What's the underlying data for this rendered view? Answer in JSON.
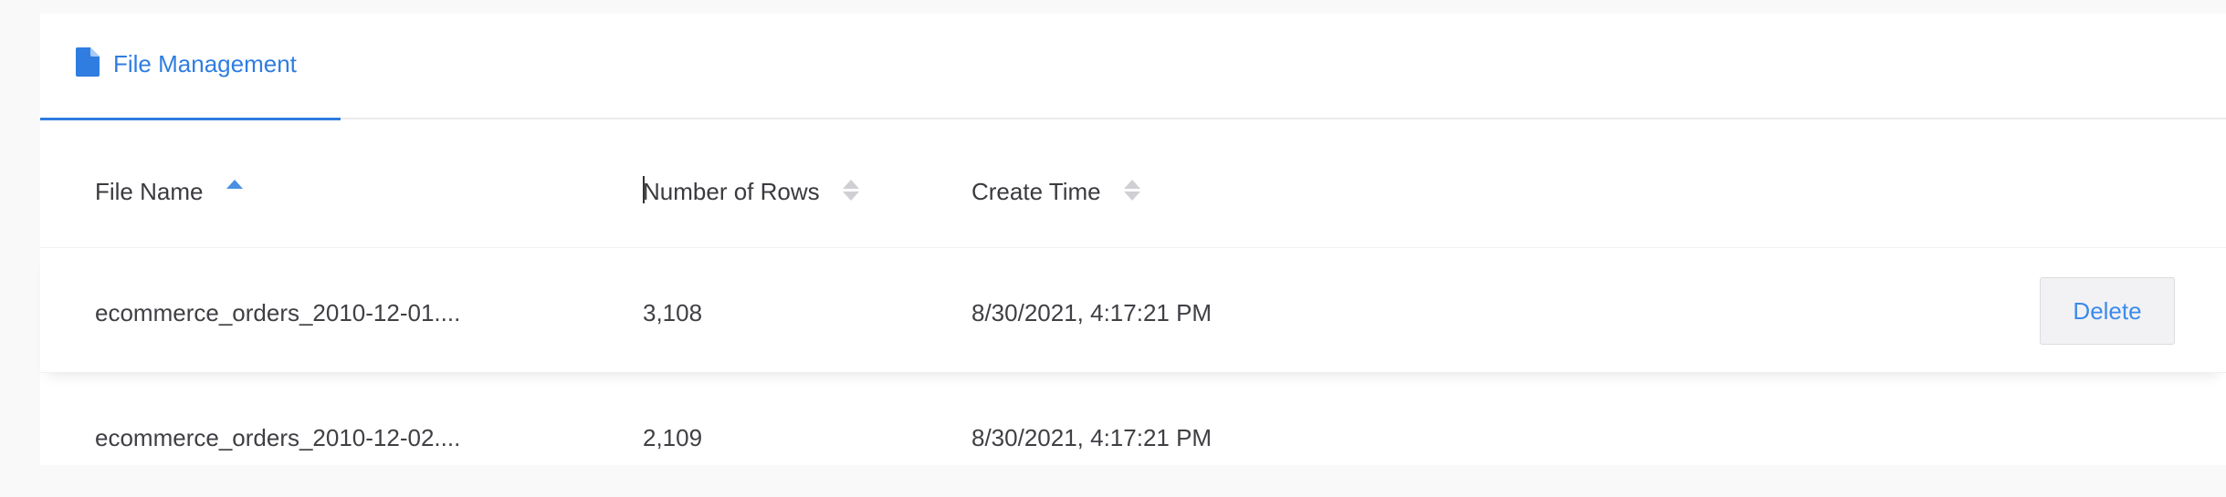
{
  "tabs": [
    {
      "label": "File Management",
      "icon": "file-icon",
      "active": true
    }
  ],
  "table": {
    "columns": [
      {
        "label": "File Name",
        "sort": "ascending"
      },
      {
        "label": "Number of Rows",
        "sort": "none"
      },
      {
        "label": "Create Time",
        "sort": "none"
      }
    ],
    "rows": [
      {
        "file_name": "ecommerce_orders_2010-12-01....",
        "number_of_rows": "3,108",
        "create_time": "8/30/2021, 4:17:21 PM",
        "action_label": "Delete"
      },
      {
        "file_name": "ecommerce_orders_2010-12-02....",
        "number_of_rows": "2,109",
        "create_time": "8/30/2021, 4:17:21 PM"
      }
    ]
  },
  "colors": {
    "accent": "#2f7de1",
    "sort_active": "#4a90e2",
    "sort_inactive": "#d0d0d4"
  }
}
